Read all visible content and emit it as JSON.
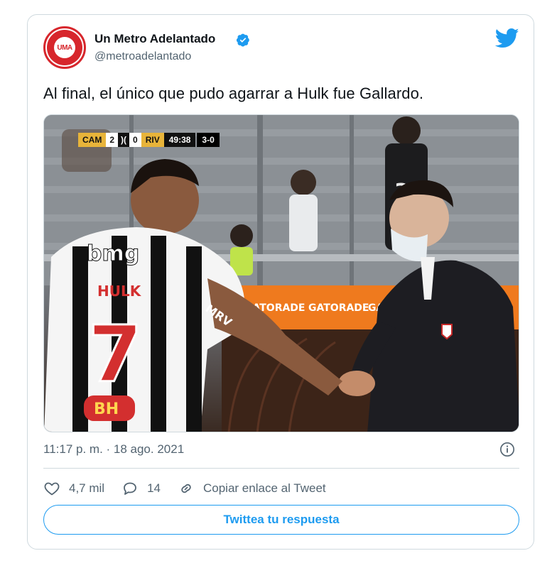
{
  "author": {
    "display_name": "Un Metro Adelantado",
    "handle": "@metroadelantado",
    "avatar_text": "UMA"
  },
  "tweet": {
    "text": "Al final, el único que pudo agarrar a Hulk fue Gallardo.",
    "timestamp": "11:17 p. m. · 18 ago. 2021"
  },
  "media": {
    "scorebug": {
      "home_team": "CAM",
      "home_score": "2",
      "away_score": "0",
      "away_team": "RIV",
      "clock": "49:38",
      "aggregate": "3-0"
    },
    "jersey_sponsor": "bmg",
    "jersey_name": "HULK",
    "jersey_number": "7",
    "jersey_side_text": "MRV",
    "shorts_logo": "BH",
    "board_text": "GATORADE"
  },
  "actions": {
    "likes": "4,7 mil",
    "replies": "14",
    "copy_link": "Copiar enlace al Tweet"
  },
  "reply_button": "Twittea tu respuesta",
  "colors": {
    "accent": "#1d9bf0",
    "secondary_text": "#536471",
    "avatar_red": "#d7262c"
  },
  "icons": [
    "verified-badge-icon",
    "twitter-bird-icon",
    "info-icon",
    "heart-icon",
    "comment-icon",
    "link-icon"
  ]
}
